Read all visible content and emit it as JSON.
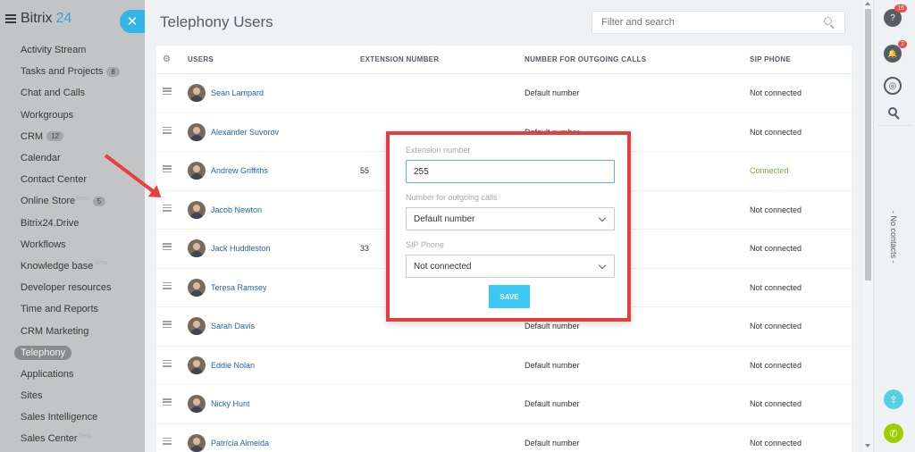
{
  "sidebar": {
    "logo_name": "Bitrix",
    "logo_num": "24",
    "close_glyph": "✕",
    "items": [
      {
        "label": "Activity Stream"
      },
      {
        "label": "Tasks and Projects",
        "badge": "8"
      },
      {
        "label": "Chat and Calls"
      },
      {
        "label": "Workgroups"
      },
      {
        "label": "CRM",
        "badge": "12"
      },
      {
        "label": "Calendar"
      },
      {
        "label": "Contact Center"
      },
      {
        "label": "Online Store",
        "beta": "beta",
        "badge": "5"
      },
      {
        "label": "Bitrix24.Drive"
      },
      {
        "label": "Workflows"
      },
      {
        "label": "Knowledge base",
        "beta": "beta"
      },
      {
        "label": "Developer resources"
      },
      {
        "label": "Time and Reports"
      },
      {
        "label": "CRM Marketing"
      },
      {
        "label": "Telephony",
        "active": true
      },
      {
        "label": "Applications"
      },
      {
        "label": "Sites"
      },
      {
        "label": "Sales Intelligence"
      },
      {
        "label": "Sales Center",
        "beta": "beta"
      }
    ]
  },
  "header": {
    "title": "Telephony Users",
    "search_placeholder": "Filter and search"
  },
  "table": {
    "gear_glyph": "⚙",
    "columns": {
      "users": "USERS",
      "extension": "EXTENSION NUMBER",
      "outgoing": "NUMBER FOR OUTGOING CALLS",
      "sip": "SIP PHONE"
    },
    "rows": [
      {
        "name": "Sean Lampard",
        "ext": "",
        "out": "Default number",
        "sip": "Not connected"
      },
      {
        "name": "Alexander Suvorov",
        "ext": "",
        "out": "Default number",
        "sip": "Not connected"
      },
      {
        "name": "Andrew Griffiths",
        "ext": "55",
        "out": "",
        "sip": "Connected"
      },
      {
        "name": "Jacob Newton",
        "ext": "",
        "out": "",
        "sip": "Not connected"
      },
      {
        "name": "Jack Huddleston",
        "ext": "33",
        "out": "",
        "sip": "Not connected"
      },
      {
        "name": "Teresa Ramsey",
        "ext": "",
        "out": "",
        "sip": "Not connected"
      },
      {
        "name": "Sarah Davis",
        "ext": "",
        "out": "Default number",
        "sip": "Not connected"
      },
      {
        "name": "Eddie Nolan",
        "ext": "",
        "out": "Default number",
        "sip": "Not connected"
      },
      {
        "name": "Nicky Hunt",
        "ext": "",
        "out": "Default number",
        "sip": "Not connected"
      },
      {
        "name": "Patrícia Almeida",
        "ext": "",
        "out": "Default number",
        "sip": "Not connected"
      }
    ]
  },
  "popup": {
    "ext_label": "Extension number",
    "ext_value": "255",
    "out_label": "Number for outgoing calls",
    "out_value": "Default number",
    "sip_label": "SIP Phone",
    "sip_value": "Not connected",
    "save_label": "SAVE"
  },
  "right_panel": {
    "help_glyph": "?",
    "help_badge": "16",
    "bell_glyph": "🔔",
    "bell_badge": "2",
    "chat_glyph": "◎",
    "no_contacts": "- No contacts -",
    "transfer_glyph": "⇪",
    "call_glyph": "✆"
  },
  "colors": {
    "accent": "#3bc8f5",
    "connected": "#7bb042",
    "highlight_border": "#e43e3e",
    "link": "#2067b0"
  }
}
